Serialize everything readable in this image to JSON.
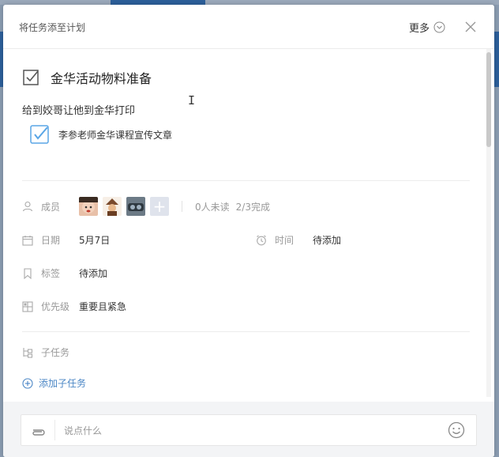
{
  "dialog": {
    "title": "将任务添至计划",
    "more_label": "更多"
  },
  "task": {
    "title": "金华活动物料准备",
    "description": "给到姣哥让他到金华打印",
    "subtask_text": "李参老师金华课程宣传文章"
  },
  "details": {
    "members": {
      "label": "成员",
      "unread": "0人未读",
      "progress": "2/3完成"
    },
    "date": {
      "label": "日期",
      "value": "5月7日"
    },
    "time": {
      "label": "时间",
      "value": "待添加"
    },
    "tags": {
      "label": "标签",
      "value": "待添加"
    },
    "priority": {
      "label": "优先级",
      "value": "重要且紧急"
    }
  },
  "subtasks": {
    "label": "子任务",
    "add_label": "添加子任务"
  },
  "comment": {
    "placeholder": "说点什么"
  },
  "colors": {
    "accent": "#4a86c5",
    "checkbox_blue": "#5aa6e6"
  }
}
